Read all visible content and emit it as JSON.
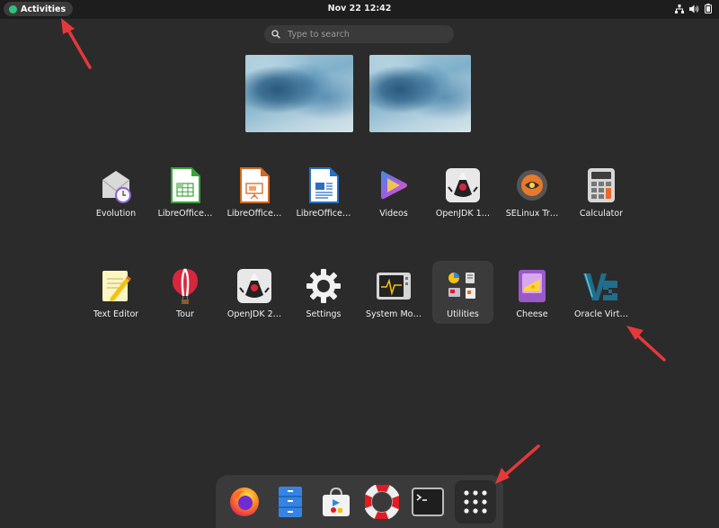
{
  "topbar": {
    "activities_label": "Activities",
    "clock": "Nov 22  12:42",
    "status_icons": [
      "network-icon",
      "volume-icon",
      "battery-icon"
    ]
  },
  "search": {
    "placeholder": "Type to search"
  },
  "workspaces": [
    "workspace-1",
    "workspace-2"
  ],
  "apps_row1": [
    {
      "name": "Evolution",
      "icon": "evolution-icon"
    },
    {
      "name": "LibreOffice…",
      "icon": "libreoffice-calc-icon"
    },
    {
      "name": "LibreOffice…",
      "icon": "libreoffice-impress-icon"
    },
    {
      "name": "LibreOffice…",
      "icon": "libreoffice-writer-icon"
    },
    {
      "name": "Videos",
      "icon": "videos-icon"
    },
    {
      "name": "OpenJDK 1…",
      "icon": "openjdk-icon"
    },
    {
      "name": "SELinux Tr…",
      "icon": "selinux-icon"
    },
    {
      "name": "Calculator",
      "icon": "calculator-icon"
    }
  ],
  "apps_row2": [
    {
      "name": "Text Editor",
      "icon": "text-editor-icon"
    },
    {
      "name": "Tour",
      "icon": "tour-balloon-icon"
    },
    {
      "name": "OpenJDK 2…",
      "icon": "openjdk-icon"
    },
    {
      "name": "Settings",
      "icon": "gear-icon"
    },
    {
      "name": "System Mo…",
      "icon": "system-monitor-icon"
    },
    {
      "name": "Utilities",
      "icon": "utilities-folder-icon"
    },
    {
      "name": "Cheese",
      "icon": "cheese-icon"
    },
    {
      "name": "Oracle Virt…",
      "icon": "virtualbox-icon"
    }
  ],
  "dock": [
    "firefox-icon",
    "files-icon",
    "software-icon",
    "help-lifebuoy-icon",
    "terminal-icon",
    "app-grid-icon"
  ],
  "colors": {
    "background": "#2b2b2b",
    "topbar": "#1d1d1d",
    "arrow": "#e5383b",
    "highlight": "#3b3b3b"
  }
}
